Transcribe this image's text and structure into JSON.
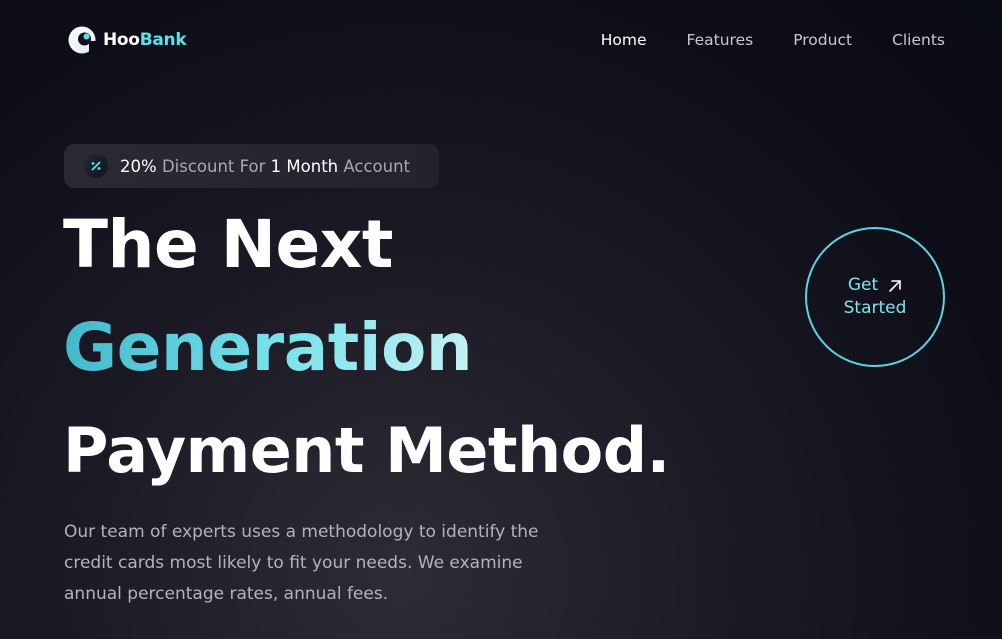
{
  "brand": {
    "name_part1": "Hoo",
    "name_part2": "Bank"
  },
  "nav": {
    "items": [
      {
        "label": "Home",
        "active": true
      },
      {
        "label": "Features",
        "active": false
      },
      {
        "label": "Product",
        "active": false
      },
      {
        "label": "Clients",
        "active": false
      }
    ]
  },
  "discount": {
    "icon": "percent-icon",
    "percent": "20%",
    "text1": "Discount For",
    "duration": "1 Month",
    "text2": "Account"
  },
  "hero": {
    "line1": "The Next",
    "line2": "Generation",
    "line3": "Payment Method.",
    "description": "Our team of experts uses a methodology to identify the credit cards most likely to fit your needs. We examine annual percentage rates, annual fees."
  },
  "cta": {
    "line1": "Get",
    "line2": "Started",
    "icon": "arrow-up-right-icon"
  },
  "colors": {
    "accent": "#5ce1e6",
    "background": "#0e0e18",
    "text_muted": "#b4b3bd"
  }
}
